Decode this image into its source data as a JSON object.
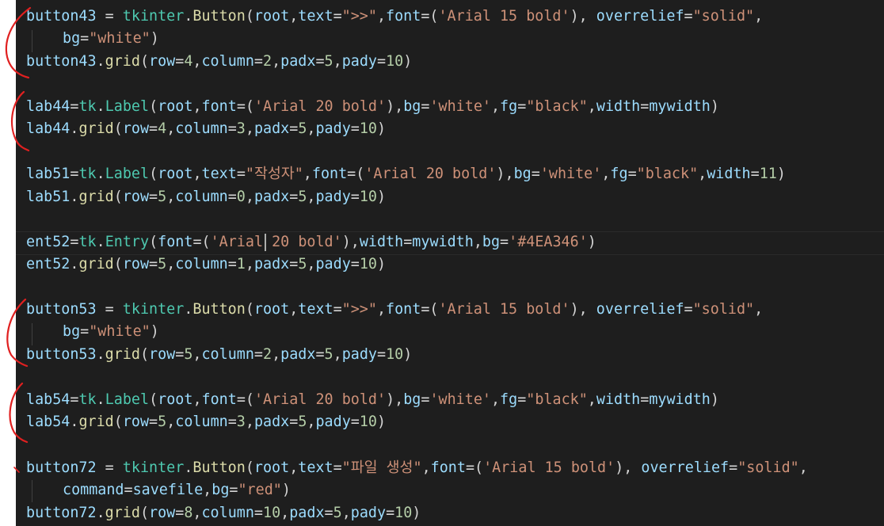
{
  "code": {
    "lines": [
      [
        [
          "v",
          "button43"
        ],
        [
          "p",
          " = "
        ],
        [
          "t",
          "tkinter"
        ],
        [
          "p",
          "."
        ],
        [
          "f",
          "Button"
        ],
        [
          "p",
          "("
        ],
        [
          "v",
          "root"
        ],
        [
          "p",
          ","
        ],
        [
          "v",
          "text"
        ],
        [
          "p",
          "="
        ],
        [
          "s",
          "\">>\""
        ],
        [
          "p",
          ","
        ],
        [
          "v",
          "font"
        ],
        [
          "p",
          "=("
        ],
        [
          "s",
          "'Arial 15 bold'"
        ],
        [
          "p",
          "), "
        ],
        [
          "v",
          "overrelief"
        ],
        [
          "p",
          "="
        ],
        [
          "s",
          "\"solid\""
        ],
        [
          "p",
          ","
        ]
      ],
      [
        [
          "v",
          "bg"
        ],
        [
          "p",
          "="
        ],
        [
          "s",
          "\"white\""
        ],
        [
          "p",
          ")"
        ]
      ],
      [
        [
          "v",
          "button43"
        ],
        [
          "p",
          "."
        ],
        [
          "f",
          "grid"
        ],
        [
          "p",
          "("
        ],
        [
          "v",
          "row"
        ],
        [
          "p",
          "="
        ],
        [
          "n",
          "4"
        ],
        [
          "p",
          ","
        ],
        [
          "v",
          "column"
        ],
        [
          "p",
          "="
        ],
        [
          "n",
          "2"
        ],
        [
          "p",
          ","
        ],
        [
          "v",
          "padx"
        ],
        [
          "p",
          "="
        ],
        [
          "n",
          "5"
        ],
        [
          "p",
          ","
        ],
        [
          "v",
          "pady"
        ],
        [
          "p",
          "="
        ],
        [
          "n",
          "10"
        ],
        [
          "p",
          ")"
        ]
      ],
      [
        [
          "v",
          "lab44"
        ],
        [
          "p",
          "="
        ],
        [
          "t",
          "tk"
        ],
        [
          "p",
          "."
        ],
        [
          "t",
          "Label"
        ],
        [
          "p",
          "("
        ],
        [
          "v",
          "root"
        ],
        [
          "p",
          ","
        ],
        [
          "v",
          "font"
        ],
        [
          "p",
          "=("
        ],
        [
          "s",
          "'Arial 20 bold'"
        ],
        [
          "p",
          "),"
        ],
        [
          "v",
          "bg"
        ],
        [
          "p",
          "="
        ],
        [
          "s",
          "'white'"
        ],
        [
          "p",
          ","
        ],
        [
          "v",
          "fg"
        ],
        [
          "p",
          "="
        ],
        [
          "s",
          "\"black\""
        ],
        [
          "p",
          ","
        ],
        [
          "v",
          "width"
        ],
        [
          "p",
          "="
        ],
        [
          "v",
          "mywidth"
        ],
        [
          "p",
          ")"
        ]
      ],
      [
        [
          "v",
          "lab44"
        ],
        [
          "p",
          "."
        ],
        [
          "f",
          "grid"
        ],
        [
          "p",
          "("
        ],
        [
          "v",
          "row"
        ],
        [
          "p",
          "="
        ],
        [
          "n",
          "4"
        ],
        [
          "p",
          ","
        ],
        [
          "v",
          "column"
        ],
        [
          "p",
          "="
        ],
        [
          "n",
          "3"
        ],
        [
          "p",
          ","
        ],
        [
          "v",
          "padx"
        ],
        [
          "p",
          "="
        ],
        [
          "n",
          "5"
        ],
        [
          "p",
          ","
        ],
        [
          "v",
          "pady"
        ],
        [
          "p",
          "="
        ],
        [
          "n",
          "10"
        ],
        [
          "p",
          ")"
        ]
      ],
      [
        [
          "v",
          "lab51"
        ],
        [
          "p",
          "="
        ],
        [
          "t",
          "tk"
        ],
        [
          "p",
          "."
        ],
        [
          "t",
          "Label"
        ],
        [
          "p",
          "("
        ],
        [
          "v",
          "root"
        ],
        [
          "p",
          ","
        ],
        [
          "v",
          "text"
        ],
        [
          "p",
          "="
        ],
        [
          "s",
          "\"작성자\""
        ],
        [
          "p",
          ","
        ],
        [
          "v",
          "font"
        ],
        [
          "p",
          "=("
        ],
        [
          "s",
          "'Arial 20 bold'"
        ],
        [
          "p",
          "),"
        ],
        [
          "v",
          "bg"
        ],
        [
          "p",
          "="
        ],
        [
          "s",
          "'white'"
        ],
        [
          "p",
          ","
        ],
        [
          "v",
          "fg"
        ],
        [
          "p",
          "="
        ],
        [
          "s",
          "\"black\""
        ],
        [
          "p",
          ","
        ],
        [
          "v",
          "width"
        ],
        [
          "p",
          "="
        ],
        [
          "n",
          "11"
        ],
        [
          "p",
          ")"
        ]
      ],
      [
        [
          "v",
          "lab51"
        ],
        [
          "p",
          "."
        ],
        [
          "f",
          "grid"
        ],
        [
          "p",
          "("
        ],
        [
          "v",
          "row"
        ],
        [
          "p",
          "="
        ],
        [
          "n",
          "5"
        ],
        [
          "p",
          ","
        ],
        [
          "v",
          "column"
        ],
        [
          "p",
          "="
        ],
        [
          "n",
          "0"
        ],
        [
          "p",
          ","
        ],
        [
          "v",
          "padx"
        ],
        [
          "p",
          "="
        ],
        [
          "n",
          "5"
        ],
        [
          "p",
          ","
        ],
        [
          "v",
          "pady"
        ],
        [
          "p",
          "="
        ],
        [
          "n",
          "10"
        ],
        [
          "p",
          ")"
        ]
      ],
      [
        [
          "v",
          "ent52"
        ],
        [
          "p",
          "="
        ],
        [
          "t",
          "tk"
        ],
        [
          "p",
          "."
        ],
        [
          "t",
          "Entry"
        ],
        [
          "p",
          "("
        ],
        [
          "v",
          "font"
        ],
        [
          "p",
          "="
        ],
        [
          "p",
          "("
        ],
        [
          "s",
          "'Arial 20 bold'"
        ],
        [
          "p",
          ")"
        ],
        [
          "p",
          ","
        ],
        [
          "v",
          "width"
        ],
        [
          "p",
          "="
        ],
        [
          "v",
          "mywidth"
        ],
        [
          "p",
          ","
        ],
        [
          "v",
          "bg"
        ],
        [
          "p",
          "="
        ],
        [
          "s",
          "'#4EA346'"
        ],
        [
          "p",
          ")"
        ]
      ],
      [
        [
          "v",
          "ent52"
        ],
        [
          "p",
          "."
        ],
        [
          "f",
          "grid"
        ],
        [
          "p",
          "("
        ],
        [
          "v",
          "row"
        ],
        [
          "p",
          "="
        ],
        [
          "n",
          "5"
        ],
        [
          "p",
          ","
        ],
        [
          "v",
          "column"
        ],
        [
          "p",
          "="
        ],
        [
          "n",
          "1"
        ],
        [
          "p",
          ","
        ],
        [
          "v",
          "padx"
        ],
        [
          "p",
          "="
        ],
        [
          "n",
          "5"
        ],
        [
          "p",
          ","
        ],
        [
          "v",
          "pady"
        ],
        [
          "p",
          "="
        ],
        [
          "n",
          "10"
        ],
        [
          "p",
          ")"
        ]
      ],
      [
        [
          "v",
          "button53"
        ],
        [
          "p",
          " = "
        ],
        [
          "t",
          "tkinter"
        ],
        [
          "p",
          "."
        ],
        [
          "f",
          "Button"
        ],
        [
          "p",
          "("
        ],
        [
          "v",
          "root"
        ],
        [
          "p",
          ","
        ],
        [
          "v",
          "text"
        ],
        [
          "p",
          "="
        ],
        [
          "s",
          "\">>\""
        ],
        [
          "p",
          ","
        ],
        [
          "v",
          "font"
        ],
        [
          "p",
          "=("
        ],
        [
          "s",
          "'Arial 15 bold'"
        ],
        [
          "p",
          "), "
        ],
        [
          "v",
          "overrelief"
        ],
        [
          "p",
          "="
        ],
        [
          "s",
          "\"solid\""
        ],
        [
          "p",
          ","
        ]
      ],
      [
        [
          "v",
          "bg"
        ],
        [
          "p",
          "="
        ],
        [
          "s",
          "\"white\""
        ],
        [
          "p",
          ")"
        ]
      ],
      [
        [
          "v",
          "button53"
        ],
        [
          "p",
          "."
        ],
        [
          "f",
          "grid"
        ],
        [
          "p",
          "("
        ],
        [
          "v",
          "row"
        ],
        [
          "p",
          "="
        ],
        [
          "n",
          "5"
        ],
        [
          "p",
          ","
        ],
        [
          "v",
          "column"
        ],
        [
          "p",
          "="
        ],
        [
          "n",
          "2"
        ],
        [
          "p",
          ","
        ],
        [
          "v",
          "padx"
        ],
        [
          "p",
          "="
        ],
        [
          "n",
          "5"
        ],
        [
          "p",
          ","
        ],
        [
          "v",
          "pady"
        ],
        [
          "p",
          "="
        ],
        [
          "n",
          "10"
        ],
        [
          "p",
          ")"
        ]
      ],
      [
        [
          "v",
          "lab54"
        ],
        [
          "p",
          "="
        ],
        [
          "t",
          "tk"
        ],
        [
          "p",
          "."
        ],
        [
          "t",
          "Label"
        ],
        [
          "p",
          "("
        ],
        [
          "v",
          "root"
        ],
        [
          "p",
          ","
        ],
        [
          "v",
          "font"
        ],
        [
          "p",
          "=("
        ],
        [
          "s",
          "'Arial 20 bold'"
        ],
        [
          "p",
          "),"
        ],
        [
          "v",
          "bg"
        ],
        [
          "p",
          "="
        ],
        [
          "s",
          "'white'"
        ],
        [
          "p",
          ","
        ],
        [
          "v",
          "fg"
        ],
        [
          "p",
          "="
        ],
        [
          "s",
          "\"black\""
        ],
        [
          "p",
          ","
        ],
        [
          "v",
          "width"
        ],
        [
          "p",
          "="
        ],
        [
          "v",
          "mywidth"
        ],
        [
          "p",
          ")"
        ]
      ],
      [
        [
          "v",
          "lab54"
        ],
        [
          "p",
          "."
        ],
        [
          "f",
          "grid"
        ],
        [
          "p",
          "("
        ],
        [
          "v",
          "row"
        ],
        [
          "p",
          "="
        ],
        [
          "n",
          "5"
        ],
        [
          "p",
          ","
        ],
        [
          "v",
          "column"
        ],
        [
          "p",
          "="
        ],
        [
          "n",
          "3"
        ],
        [
          "p",
          ","
        ],
        [
          "v",
          "padx"
        ],
        [
          "p",
          "="
        ],
        [
          "n",
          "5"
        ],
        [
          "p",
          ","
        ],
        [
          "v",
          "pady"
        ],
        [
          "p",
          "="
        ],
        [
          "n",
          "10"
        ],
        [
          "p",
          ")"
        ]
      ],
      [
        [
          "v",
          "button72"
        ],
        [
          "p",
          " = "
        ],
        [
          "t",
          "tkinter"
        ],
        [
          "p",
          "."
        ],
        [
          "f",
          "Button"
        ],
        [
          "p",
          "("
        ],
        [
          "v",
          "root"
        ],
        [
          "p",
          ","
        ],
        [
          "v",
          "text"
        ],
        [
          "p",
          "="
        ],
        [
          "s",
          "\"파일 생성\""
        ],
        [
          "p",
          ","
        ],
        [
          "v",
          "font"
        ],
        [
          "p",
          "=("
        ],
        [
          "s",
          "'Arial 15 bold'"
        ],
        [
          "p",
          "), "
        ],
        [
          "v",
          "overrelief"
        ],
        [
          "p",
          "="
        ],
        [
          "s",
          "\"solid\""
        ],
        [
          "p",
          ","
        ]
      ],
      [
        [
          "v",
          "command"
        ],
        [
          "p",
          "="
        ],
        [
          "v",
          "savefile"
        ],
        [
          "p",
          ","
        ],
        [
          "v",
          "bg"
        ],
        [
          "p",
          "="
        ],
        [
          "s",
          "\"red\""
        ],
        [
          "p",
          ")"
        ]
      ],
      [
        [
          "v",
          "button72"
        ],
        [
          "p",
          "."
        ],
        [
          "f",
          "grid"
        ],
        [
          "p",
          "("
        ],
        [
          "v",
          "row"
        ],
        [
          "p",
          "="
        ],
        [
          "n",
          "8"
        ],
        [
          "p",
          ","
        ],
        [
          "v",
          "column"
        ],
        [
          "p",
          "="
        ],
        [
          "n",
          "10"
        ],
        [
          "p",
          ","
        ],
        [
          "v",
          "padx"
        ],
        [
          "p",
          "="
        ],
        [
          "n",
          "5"
        ],
        [
          "p",
          ","
        ],
        [
          "v",
          "pady"
        ],
        [
          "p",
          "="
        ],
        [
          "n",
          "10"
        ],
        [
          "p",
          ")"
        ]
      ]
    ]
  },
  "theme": {
    "editor_bg": "#1e1e1e",
    "variable": "#9cdcfe",
    "function": "#dcdcaa",
    "class": "#4ec9b0",
    "string": "#ce9178",
    "number": "#b5cea8",
    "punctuation": "#d4d4d4",
    "annotation_ink": "#e02020"
  }
}
